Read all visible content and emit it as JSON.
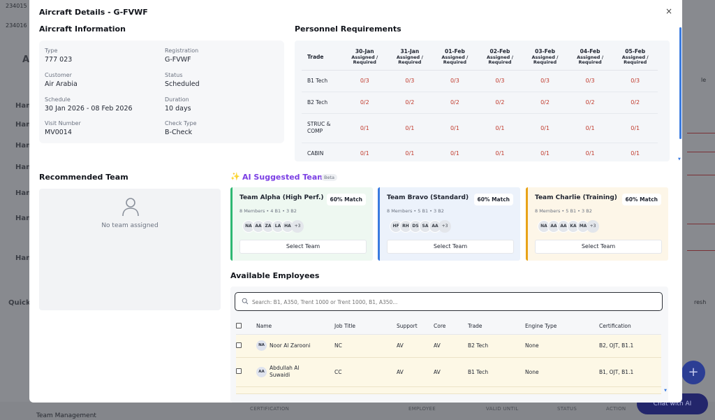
{
  "background": {
    "left_ids": [
      "234015",
      "234016"
    ],
    "left_letters": [
      "A",
      "Han",
      "Han",
      "Han",
      "Han",
      "Han",
      "Han",
      "Han",
      "Quick"
    ],
    "right_text": [
      "le",
      "resh"
    ],
    "bottom_labels": [
      "CERTIFICATION",
      "EMPLOYEE",
      "VALID UNTIL",
      "STATUS",
      "ACTION"
    ],
    "team_management": "Team Management",
    "chat_label": "Chat with AI",
    "fab_symbol": "+"
  },
  "modal": {
    "title": "Aircraft Details - G-FVWF",
    "close_symbol": "×"
  },
  "aircraft_info": {
    "title": "Aircraft Information",
    "fields": [
      {
        "label": "Type",
        "value": "777 023"
      },
      {
        "label": "Registration",
        "value": "G-FVWF"
      },
      {
        "label": "Customer",
        "value": "Air Arabia"
      },
      {
        "label": "Status",
        "value": "Scheduled"
      },
      {
        "label": "Schedule",
        "value": "30 Jan 2026 - 08 Feb 2026"
      },
      {
        "label": "Duration",
        "value": "10 days"
      },
      {
        "label": "Visit Number",
        "value": "MV0014"
      },
      {
        "label": "Check Type",
        "value": "B-Check"
      }
    ]
  },
  "personnel": {
    "title": "Personnel Requirements",
    "trade_header": "Trade",
    "sub_header": "Assigned / Required",
    "dates": [
      "30-Jan",
      "31-Jan",
      "01-Feb",
      "02-Feb",
      "03-Feb",
      "04-Feb",
      "05-Feb"
    ],
    "rows": [
      {
        "trade": "B1 Tech",
        "values": [
          "0/3",
          "0/3",
          "0/3",
          "0/3",
          "0/3",
          "0/3",
          "0/3"
        ]
      },
      {
        "trade": "B2 Tech",
        "values": [
          "0/2",
          "0/2",
          "0/2",
          "0/2",
          "0/2",
          "0/2",
          "0/2"
        ]
      },
      {
        "trade": "STRUC & COMP",
        "values": [
          "0/1",
          "0/1",
          "0/1",
          "0/1",
          "0/1",
          "0/1",
          "0/1"
        ]
      },
      {
        "trade": "CABIN",
        "values": [
          "0/1",
          "0/1",
          "0/1",
          "0/1",
          "0/1",
          "0/1",
          "0/1"
        ]
      }
    ]
  },
  "recommended": {
    "title": "Recommended Team",
    "empty_text": "No team assigned"
  },
  "ai_teams": {
    "title": "AI Suggested Teams",
    "beta": "Beta",
    "select_label": "Select Team",
    "teams": [
      {
        "name": "Team Alpha (High Perf.)",
        "match": "60% Match",
        "meta": "8 Members • 4 B1 • 3 B2",
        "avatars": [
          "NA",
          "AA",
          "ZA",
          "LA",
          "HA"
        ],
        "more": "+3",
        "accent": "#2eb872",
        "bg": "#eef8f1"
      },
      {
        "name": "Team Bravo (Standard)",
        "match": "60% Match",
        "meta": "8 Members • 5 B1 • 3 B2",
        "avatars": [
          "HF",
          "RH",
          "DS",
          "SA",
          "AA"
        ],
        "more": "+3",
        "accent": "#3a7be0",
        "bg": "#ecf2fb"
      },
      {
        "name": "Team Charlie (Training)",
        "match": "60% Match",
        "meta": "8 Members • 5 B1 • 3 B2",
        "avatars": [
          "NA",
          "AA",
          "AA",
          "KA",
          "MA"
        ],
        "more": "+3",
        "accent": "#e8a317",
        "bg": "#fdf6e8"
      }
    ]
  },
  "employees": {
    "title": "Available Employees",
    "search_placeholder": "Search: B1, A350, Trent 1000 or Trent 1000, B1, A350...",
    "columns": [
      "Name",
      "Job Title",
      "Support",
      "Core",
      "Trade",
      "Engine Type",
      "Certification"
    ],
    "rows": [
      {
        "initials": "NA",
        "name": "Noor Al Zarooni",
        "job": "NC",
        "support": "AV",
        "core": "AV",
        "trade": "B2 Tech",
        "engine": "None",
        "cert": "B2, OJT, B1.1"
      },
      {
        "initials": "AA",
        "name": "Abdullah Al Suwaidi",
        "job": "CC",
        "support": "AV",
        "core": "AV",
        "trade": "B1 Tech",
        "engine": "None",
        "cert": "B1, OJT, B1.1"
      }
    ]
  }
}
